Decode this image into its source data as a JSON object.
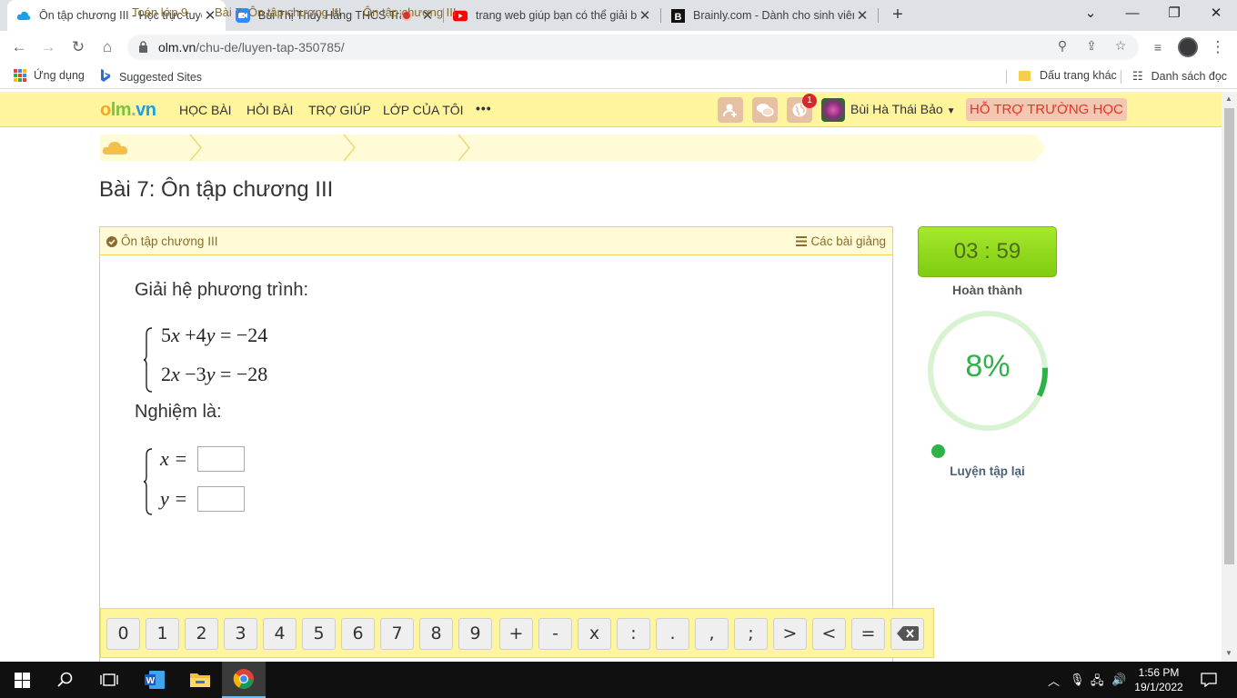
{
  "browser": {
    "tabs": [
      {
        "title": "Ôn tập chương III - Học trực tuyến",
        "active": true
      },
      {
        "title": "Bùi Thị Thúy Hằng THCS Trần",
        "active": false
      },
      {
        "title": "trang web giúp bạn có thể giải bài",
        "active": false
      },
      {
        "title": "Brainly.com - Dành cho sinh viên",
        "active": false
      }
    ],
    "url_host": "olm.vn",
    "url_path": "/chu-de/luyen-tap-350785/",
    "bookmarks": {
      "apps": "Ứng dụng",
      "suggested": "Suggested Sites",
      "other": "Dấu trang khác",
      "reading_list": "Danh sách đọc"
    }
  },
  "site": {
    "logo_parts": [
      "o",
      "l",
      "m",
      ".",
      "v",
      "n"
    ],
    "menu": [
      "HỌC BÀI",
      "HỎI BÀI",
      "TRỢ GIÚP",
      "LỚP CỦA TÔI"
    ],
    "more": "•••",
    "notification_count": "1",
    "user_name": "Bùi Hà Thái Bảo",
    "support": "HỖ TRỢ TRƯỜNG HỌC"
  },
  "breadcrumb": [
    "Toán lớp 9",
    "Bài 7: Ôn tập chương III",
    "Ôn tập chương III"
  ],
  "page_title": "Bài 7: Ôn tập chương III",
  "exercise": {
    "header_left": "Ôn tập chương III",
    "header_right": "Các bài giảng",
    "prompt": "Giải hệ phương trình:",
    "eq1": {
      "a": "5",
      "x": "x",
      "op": "+4",
      "y": "y",
      "rhs": "= −24"
    },
    "eq2": {
      "a": "2",
      "x": "x",
      "op": "−3",
      "y": "y",
      "rhs": "= −28"
    },
    "answer_prompt": "Nghiệm là:",
    "answer_x_label": "x =",
    "answer_y_label": "y =",
    "answer_x_value": "",
    "answer_y_value": ""
  },
  "keypad": [
    "0",
    "1",
    "2",
    "3",
    "4",
    "5",
    "6",
    "7",
    "8",
    "9",
    "+",
    "-",
    "x",
    ":",
    ".",
    ",",
    ";",
    ">",
    "<",
    "="
  ],
  "sidebar": {
    "timer": "03 : 59",
    "status": "Hoàn thành",
    "progress_percent": 8,
    "progress_label": "8%",
    "retry": "Luyện tập lại"
  },
  "taskbar": {
    "time": "1:56 PM",
    "date": "19/1/2022"
  },
  "colors": {
    "accent_yellow": "#fff59c",
    "progress_green": "#2db34a",
    "timer_green": "#8fd61c",
    "support_red": "#e0362b"
  }
}
